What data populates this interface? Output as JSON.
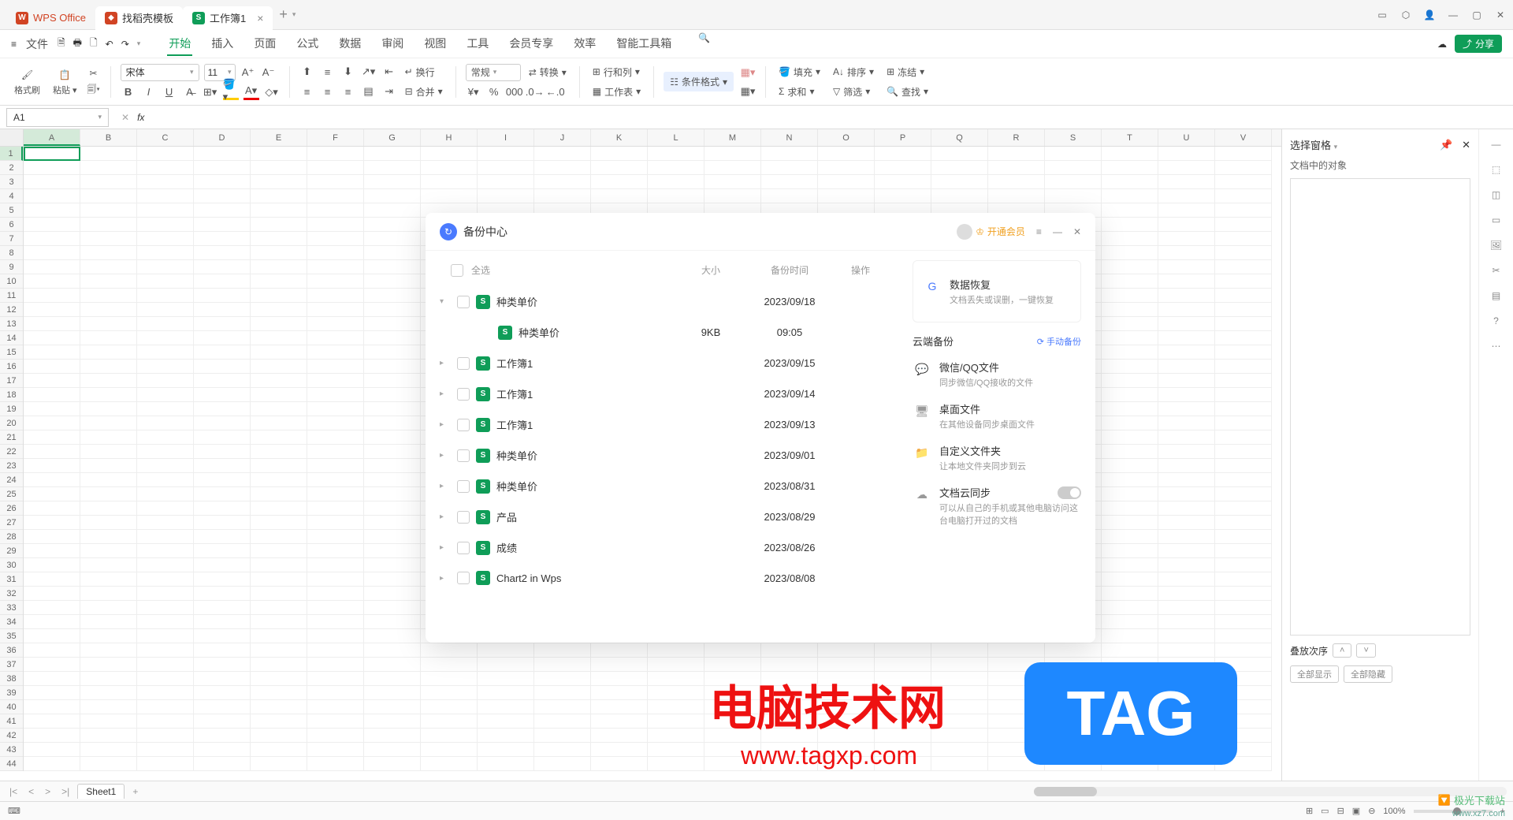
{
  "titlebar": {
    "app_name": "WPS Office",
    "template_tab": "找稻壳模板",
    "doc_tab": "工作簿1"
  },
  "menubar": {
    "file": "文件",
    "tabs": [
      "开始",
      "插入",
      "页面",
      "公式",
      "数据",
      "审阅",
      "视图",
      "工具",
      "会员专享",
      "效率",
      "智能工具箱"
    ],
    "share": "分享"
  },
  "ribbon": {
    "format_painter": "格式刷",
    "paste": "粘贴",
    "font_name": "宋体",
    "font_size": "11",
    "wrap": "换行",
    "merge": "合并",
    "general": "常规",
    "convert": "转换",
    "row_col": "行和列",
    "worksheet": "工作表",
    "cond_fmt": "条件格式",
    "fill": "填充",
    "sort": "排序",
    "freeze": "冻结",
    "sum": "求和",
    "filter": "筛选",
    "find": "查找"
  },
  "fbar": {
    "cell": "A1",
    "fx": "fx"
  },
  "columns": [
    "A",
    "B",
    "C",
    "D",
    "E",
    "F",
    "G",
    "H",
    "I",
    "J",
    "K",
    "L",
    "M",
    "N",
    "O",
    "P",
    "Q",
    "R",
    "S",
    "T",
    "U",
    "V"
  ],
  "right_panel": {
    "title": "选择窗格",
    "objects": "文档中的对象",
    "order": "叠放次序",
    "show_all": "全部显示",
    "hide_all": "全部隐藏"
  },
  "sheet_tabs": {
    "sheet1": "Sheet1"
  },
  "statusbar": {
    "zoom": "100%"
  },
  "dialog": {
    "title": "备份中心",
    "vip": "开通会员",
    "select_all": "全选",
    "col_size": "大小",
    "col_time": "备份时间",
    "col_op": "操作",
    "files": [
      {
        "name": "种类单价",
        "time": "2023/09/18",
        "size": "",
        "child": {
          "name": "种类单价",
          "size": "9KB",
          "time": "09:05"
        }
      },
      {
        "name": "工作簿1",
        "time": "2023/09/15"
      },
      {
        "name": "工作簿1",
        "time": "2023/09/14"
      },
      {
        "name": "工作簿1",
        "time": "2023/09/13"
      },
      {
        "name": "种类单价",
        "time": "2023/09/01"
      },
      {
        "name": "种类单价",
        "time": "2023/08/31"
      },
      {
        "name": "产品",
        "time": "2023/08/29"
      },
      {
        "name": "成绩",
        "time": "2023/08/26"
      },
      {
        "name": "Chart2 in Wps",
        "time": "2023/08/08"
      }
    ],
    "side": {
      "recover_title": "数据恢复",
      "recover_sub": "文档丢失或误删，一键恢复",
      "cloud_title": "云端备份",
      "manual": "手动备份",
      "wechat_title": "微信/QQ文件",
      "wechat_sub": "同步微信/QQ接收的文件",
      "desktop_title": "桌面文件",
      "desktop_sub": "在其他设备同步桌面文件",
      "custom_title": "自定义文件夹",
      "custom_sub": "让本地文件夹同步到云",
      "sync_title": "文档云同步",
      "sync_sub": "可以从自己的手机或其他电脑访问这台电脑打开过的文档"
    }
  },
  "watermark": {
    "wm1": "电脑技术网",
    "wm1_sub": "www.tagxp.com",
    "wm2": "TAG",
    "wm3": "极光下载站",
    "wm3b": "www.xz7.com"
  }
}
